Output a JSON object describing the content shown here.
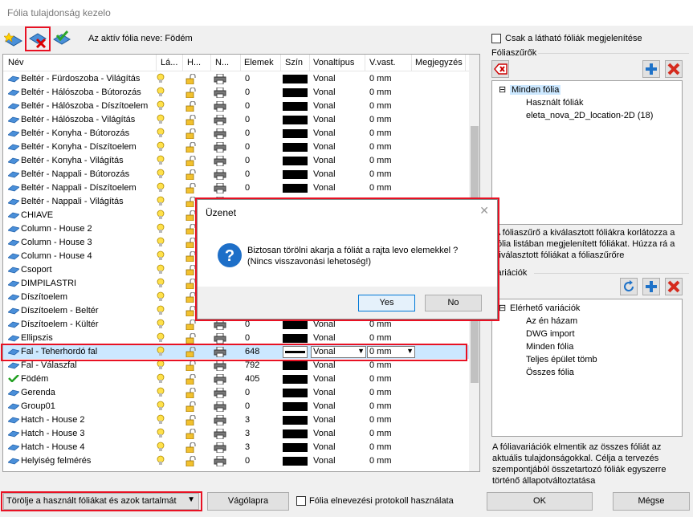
{
  "window": {
    "title": "Fólia tulajdonság kezelo"
  },
  "toolbar": {
    "active_layer_label": "Az aktív fólia neve: Födém"
  },
  "table": {
    "headers": [
      "Név",
      "Lá...",
      "H...",
      "N...",
      "Elemek",
      "Szín",
      "Vonaltípus",
      "V.vast.",
      "Megjegyzés"
    ],
    "rows": [
      {
        "name": "Beltér - Fürdoszoba - Világítás",
        "count": "0",
        "linetype": "Vonal",
        "width": "0 mm"
      },
      {
        "name": "Beltér - Hálószoba - Bútorozás",
        "count": "0",
        "linetype": "Vonal",
        "width": "0 mm"
      },
      {
        "name": "Beltér - Hálószoba - Díszítoelem",
        "count": "0",
        "linetype": "Vonal",
        "width": "0 mm"
      },
      {
        "name": "Beltér - Hálószoba - Világítás",
        "count": "0",
        "linetype": "Vonal",
        "width": "0 mm"
      },
      {
        "name": "Beltér - Konyha - Bútorozás",
        "count": "0",
        "linetype": "Vonal",
        "width": "0 mm"
      },
      {
        "name": "Beltér - Konyha - Díszítoelem",
        "count": "0",
        "linetype": "Vonal",
        "width": "0 mm"
      },
      {
        "name": "Beltér - Konyha - Világítás",
        "count": "0",
        "linetype": "Vonal",
        "width": "0 mm"
      },
      {
        "name": "Beltér - Nappali - Bútorozás",
        "count": "0",
        "linetype": "Vonal",
        "width": "0 mm"
      },
      {
        "name": "Beltér - Nappali - Díszítoelem",
        "count": "0",
        "linetype": "Vonal",
        "width": "0 mm"
      },
      {
        "name": "Beltér - Nappali - Világítás",
        "count": "",
        "linetype": "",
        "width": ""
      },
      {
        "name": "CHIAVE",
        "count": "",
        "linetype": "",
        "width": ""
      },
      {
        "name": "Column - House 2",
        "count": "",
        "linetype": "",
        "width": ""
      },
      {
        "name": "Column - House 3",
        "count": "",
        "linetype": "",
        "width": ""
      },
      {
        "name": "Column - House 4",
        "count": "",
        "linetype": "",
        "width": ""
      },
      {
        "name": "Csoport",
        "count": "",
        "linetype": "",
        "width": ""
      },
      {
        "name": "DIMPILASTRI",
        "count": "",
        "linetype": "",
        "width": ""
      },
      {
        "name": "Díszítoelem",
        "count": "",
        "linetype": "",
        "width": ""
      },
      {
        "name": "Díszítoelem - Beltér",
        "count": "",
        "linetype": "",
        "width": ""
      },
      {
        "name": "Díszítoelem - Kültér",
        "count": "0",
        "linetype": "Vonal",
        "width": "0 mm"
      },
      {
        "name": "Ellipszis",
        "count": "0",
        "linetype": "Vonal",
        "width": "0 mm"
      },
      {
        "name": "Fal - Teherhordó fal",
        "count": "648",
        "linetype": "Vonal",
        "width": "0 mm"
      },
      {
        "name": "Fal - Válaszfal",
        "count": "792",
        "linetype": "Vonal",
        "width": "0 mm"
      },
      {
        "name": "Födém",
        "count": "405",
        "linetype": "Vonal",
        "width": "0 mm"
      },
      {
        "name": "Gerenda",
        "count": "0",
        "linetype": "Vonal",
        "width": "0 mm"
      },
      {
        "name": "Group01",
        "count": "0",
        "linetype": "Vonal",
        "width": "0 mm"
      },
      {
        "name": "Hatch - House 2",
        "count": "3",
        "linetype": "Vonal",
        "width": "0 mm"
      },
      {
        "name": "Hatch - House 3",
        "count": "3",
        "linetype": "Vonal",
        "width": "0 mm"
      },
      {
        "name": "Hatch - House 4",
        "count": "3",
        "linetype": "Vonal",
        "width": "0 mm"
      },
      {
        "name": "Helyiség felmérés",
        "count": "0",
        "linetype": "Vonal",
        "width": "0 mm"
      }
    ]
  },
  "right": {
    "visible_only_label": "Csak a látható fóliák megjelenítése",
    "filters_title": "Fóliaszűrők",
    "filters_tree": {
      "root": "Minden fólia",
      "children": [
        "Használt fóliák",
        "eleta_nova_2D_location-2D (18)"
      ]
    },
    "filters_desc": [
      "A fóliaszűrő a kiválasztott fóliákra korlátozza a",
      "fólia listában megjelenített fóliákat. Húzza rá a",
      "kiválasztott fóliákat a fóliaszűrőre"
    ],
    "variations_title": "Variációk",
    "variations_tree": {
      "root": "Elérhető variációk",
      "children": [
        "Az én házam",
        "DWG import",
        "Minden fólia",
        "Teljes épület tömb",
        "Összes fólia"
      ]
    },
    "variations_desc": [
      "A fóliavariációk elmentik az összes fóliát az",
      "aktuális tulajdonságokkal. Célja a tervezés",
      "szempontjából összetartozó fóliák egyszerre",
      "történő állapotváltoztatása"
    ]
  },
  "bottom": {
    "delete_select": "Törölje a használt fóliákat és azok tartalmát",
    "clipboard_button": "Vágólapra",
    "protocol_label": "Fólia elnevezési protokoll használata",
    "ok_button": "OK",
    "cancel_button": "Mégse"
  },
  "dialog": {
    "title": "Üzenet",
    "message_line1": "Biztosan törölni akarja a fóliát a rajta levo elemekkel ?",
    "message_line2": "(Nincs visszavonási lehetoség!)",
    "yes_button": "Yes",
    "no_button": "No"
  },
  "colors": {
    "highlight": "#e81123",
    "selection": "#cce8ff",
    "accent": "#0078d7"
  }
}
